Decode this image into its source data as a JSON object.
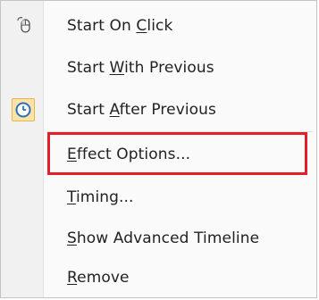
{
  "menu": {
    "items": [
      {
        "pre": "Start On ",
        "ul": "C",
        "post": "lick",
        "icon": "mouse-icon"
      },
      {
        "pre": "Start ",
        "ul": "W",
        "post": "ith Previous",
        "icon": ""
      },
      {
        "pre": "Start ",
        "ul": "A",
        "post": "fter Previous",
        "icon": "clock-icon",
        "selected": true
      },
      {
        "pre": "",
        "ul": "E",
        "post": "ffect Options...",
        "icon": "",
        "highlighted": true
      },
      {
        "pre": "",
        "ul": "T",
        "post": "iming...",
        "icon": ""
      },
      {
        "pre": "",
        "ul": "S",
        "post": "how Advanced Timeline",
        "icon": ""
      },
      {
        "pre": "",
        "ul": "R",
        "post": "emove",
        "icon": ""
      }
    ]
  },
  "colors": {
    "highlight_border": "#e21f2b",
    "selected_icon_bg": "#fde3a7",
    "clock_blue": "#2f6fb6"
  }
}
